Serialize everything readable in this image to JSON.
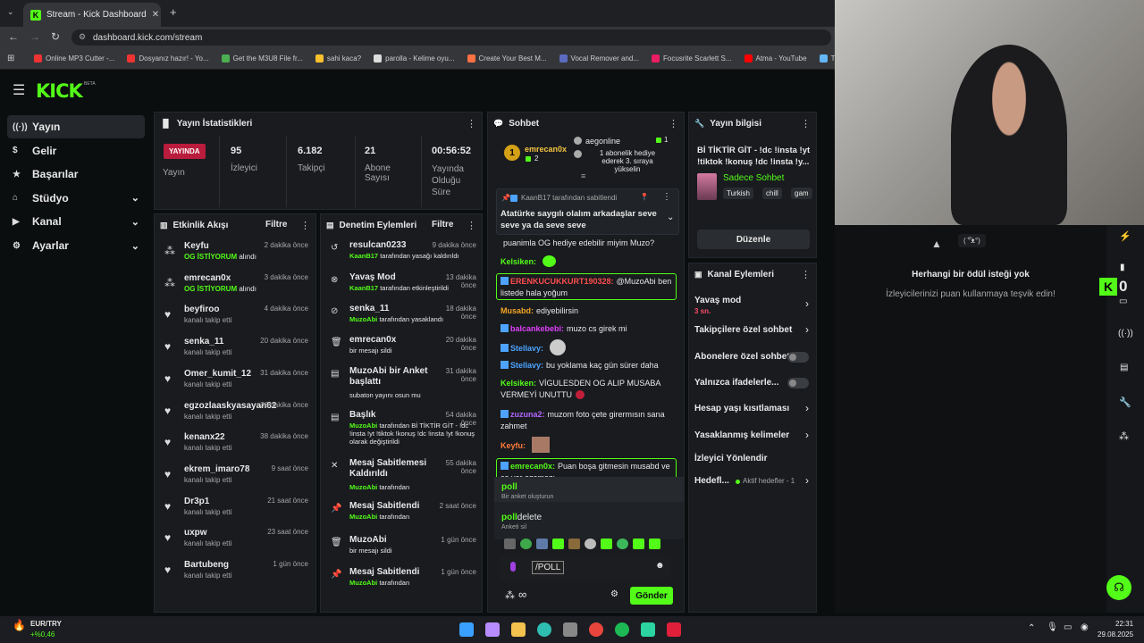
{
  "browser": {
    "tab_title": "Stream - Kick Dashboard",
    "url": "dashboard.kick.com/stream",
    "bookmarks": [
      {
        "label": "Online MP3 Cutter -...",
        "color": "#e33"
      },
      {
        "label": "Dosyanız hazır! - Yo...",
        "color": "#e33"
      },
      {
        "label": "Get the M3U8 File fr...",
        "color": "#4caf50"
      },
      {
        "label": "sahi kaca?",
        "color": "#fbc02d"
      },
      {
        "label": "parolla - Kelime oyu...",
        "color": "#ddd"
      },
      {
        "label": "Create Your Best M...",
        "color": "#ff7043"
      },
      {
        "label": "Vocal Remover and...",
        "color": "#5c6bc0"
      },
      {
        "label": "Focusrite Scarlett S...",
        "color": "#e91e63"
      },
      {
        "label": "Atma - YouTube",
        "color": "#f00"
      },
      {
        "label": "Thum",
        "color": "#64b5f6"
      }
    ]
  },
  "brand": {
    "logo": "KICK",
    "beta": "BETA",
    "accent": "#53fc18"
  },
  "sidebar": [
    {
      "label": "Yayın",
      "icon": "broadcast-icon",
      "active": true,
      "chevron": false
    },
    {
      "label": "Gelir",
      "icon": "dollar-icon",
      "active": false,
      "chevron": false
    },
    {
      "label": "Başarılar",
      "icon": "trophy-icon",
      "active": false,
      "chevron": false
    },
    {
      "label": "Stüdyo",
      "icon": "studio-icon",
      "active": false,
      "chevron": true
    },
    {
      "label": "Kanal",
      "icon": "channel-icon",
      "active": false,
      "chevron": true
    },
    {
      "label": "Ayarlar",
      "icon": "settings-icon",
      "active": false,
      "chevron": true
    }
  ],
  "stats": {
    "title": "Yayın İstatistikleri",
    "live_badge": "YAYINDA",
    "live_label": "Yayın",
    "viewers": "95",
    "viewers_label": "İzleyici",
    "followers": "6.182",
    "followers_label": "Takipçi",
    "subs": "21",
    "subs_label": "Abone Sayısı",
    "uptime": "00:56:52",
    "uptime_label": "Yayında Olduğu Süre"
  },
  "activity": {
    "title": "Etkinlik Akışı",
    "filter": "Filtre",
    "items": [
      {
        "name": "Keyfu",
        "time": "2 dakika önce",
        "hl": "OG İSTİYORUM",
        "text": " alındı"
      },
      {
        "name": "emrecan0x",
        "time": "3 dakika önce",
        "hl": "OG İSTİYORUM",
        "text": " alındı"
      },
      {
        "name": "beyfiroo",
        "time": "4 dakika önce",
        "hl": "",
        "text": "kanalı takip etti"
      },
      {
        "name": "senka_11",
        "time": "20 dakika önce",
        "hl": "",
        "text": "kanalı takip etti"
      },
      {
        "name": "Omer_kumit_12",
        "time": "31 dakika önce",
        "hl": "",
        "text": "kanalı takip etti"
      },
      {
        "name": "egzozlaaskyasayan62",
        "time": "36 dakika önce",
        "hl": "",
        "text": "kanalı takip etti"
      },
      {
        "name": "kenanx22",
        "time": "38 dakika önce",
        "hl": "",
        "text": "kanalı takip etti"
      },
      {
        "name": "ekrem_imaro78",
        "time": "9 saat önce",
        "hl": "",
        "text": "kanalı takip etti"
      },
      {
        "name": "Dr3p1",
        "time": "21 saat önce",
        "hl": "",
        "text": "kanalı takip etti"
      },
      {
        "name": "uxpw",
        "time": "23 saat önce",
        "hl": "",
        "text": "kanalı takip etti"
      },
      {
        "name": "Bartubeng",
        "time": "1 gün önce",
        "hl": "",
        "text": "kanalı takip etti"
      }
    ]
  },
  "moderation": {
    "title": "Denetim Eylemleri",
    "filter": "Filtre",
    "items": [
      {
        "title": "resulcan0233",
        "time": "9 dakika önce",
        "hl": "KaanB17",
        "text": " tarafından yasağı kaldırıldı"
      },
      {
        "title": "Yavaş Mod",
        "time": "13 dakika önce",
        "hl": "KaanB17",
        "text": " tarafından etkinleştirildi"
      },
      {
        "title": "senka_11",
        "time": "18 dakika önce",
        "hl": "MuzoAbi",
        "text": " tarafından yasaklandı"
      },
      {
        "title": "emrecan0x",
        "time": "20 dakika önce",
        "hl": "",
        "text": "bir mesajı sildi"
      },
      {
        "title": "MuzoAbi bir Anket başlattı",
        "time": "31 dakika önce",
        "hl": "",
        "text": "subaton yayını osun mu"
      },
      {
        "title": "Başlık",
        "time": "54 dakika önce",
        "hl": "MuzoAbi",
        "text": " tarafından Bİ TİKTİR GİT - !dc !insta !yt !tiktok !konuş !dc !insta !yt !konuş olarak değiştirildi"
      },
      {
        "title": "Mesaj Sabitlemesi Kaldırıldı",
        "time": "55 dakika önce",
        "hl": "MuzoAbi",
        "text": " tarafından"
      },
      {
        "title": "Mesaj Sabitlendi",
        "time": "2 saat önce",
        "hl": "MuzoAbi",
        "text": " tarafından"
      },
      {
        "title": "MuzoAbi",
        "time": "1 gün önce",
        "hl": "",
        "text": "bir mesajı sildi"
      },
      {
        "title": "Mesaj Sabitlendi",
        "time": "1 gün önce",
        "hl": "MuzoAbi",
        "text": " tarafından"
      }
    ]
  },
  "chat": {
    "title": "Sohbet",
    "top1": "emrecan0x",
    "top1_count": "2",
    "top2": "aegonline",
    "top2_count": "1",
    "top2_text": "1 abonelik hediye ederek 3. sıraya yükselin",
    "pinned_by": "KaanB17 tarafından sabitlendi",
    "pinned_text": "Atatürke saygılı olalım arkadaşlar seve seve ya da seve seve",
    "messages": [
      {
        "user": "",
        "color": "#ddd",
        "text": "puanimla OG hediye edebilir miyim Muzo?"
      },
      {
        "user": "Kelsiken:",
        "color": "#53fc18",
        "text": ""
      },
      {
        "user": "ERENKUCUKKURT190328:",
        "color": "#ff4d4d",
        "text": "@MuzoAbi ben listede hala yoğum"
      },
      {
        "user": "Musabd:",
        "color": "#f5a623",
        "text": "ediyebilirsin"
      },
      {
        "user": "balcankebebi:",
        "color": "#e040fb",
        "text": "muzo cs girek mi"
      },
      {
        "user": "Stellavy:",
        "color": "#4da3ff",
        "text": ""
      },
      {
        "user": "Stellavy:",
        "color": "#4da3ff",
        "text": "bu yoklama kaç gün sürer daha"
      },
      {
        "user": "Kelsiken:",
        "color": "#53fc18",
        "text": "VİGULESDEN OG ALIP MUSABA VERMEYİ UNUTTU"
      },
      {
        "user": "zuzuna2:",
        "color": "#b366ff",
        "text": "muzom foto çete girermısın sana zahmet"
      },
      {
        "user": "Keyfu:",
        "color": "#ff7b3a",
        "text": ""
      },
      {
        "user": "emrecan0x:",
        "color": "#53fc18",
        "text": "Puan boşa gitmesin musabd ve ço var ezamazı"
      }
    ],
    "suggest1": "poll",
    "suggest1_desc": "Bir anket oluşturun",
    "suggest2a": "poll",
    "suggest2b": "delete",
    "suggest2_desc": "Anketi sil",
    "input_value": "/POLL",
    "send": "Gönder"
  },
  "info": {
    "title": "Yayın bilgisi",
    "stream_title": "Bİ TİKTİR GİT - !dc !insta !yt !tiktok !konuş !dc !insta !y...",
    "category": "Sadece Sohbet",
    "tags": [
      "Turkish",
      "chill",
      "gam"
    ],
    "edit": "Düzenle"
  },
  "channel": {
    "title": "Kanal Eylemleri",
    "slow_mode": "Yavaş mod",
    "slow_value": "3 sn.",
    "followers_only": "Takipçilere özel sohbet",
    "subs_only": "Abonelere özel sohbet",
    "emotes_only": "Yalnızca ifadelerle...",
    "age": "Hesap yaşı kısıtlaması",
    "banned": "Yasaklanmış kelimeler",
    "redirect": "İzleyici Yönlendir",
    "goals": "Hedefl...",
    "goals_status": "Aktif hedefler - 1"
  },
  "rewards": {
    "empty_title": "Herhangi bir ödül isteği yok",
    "empty_desc": "İzleyicilerinizi puan kullanmaya teşvik edin!",
    "face": "( ͡°ᴥ°)"
  },
  "overlay": {
    "count": "0"
  },
  "taskbar": {
    "ticker": "EUR/TRY",
    "change": "+%0,46",
    "time": "22:31",
    "date": "29.08.2025"
  }
}
